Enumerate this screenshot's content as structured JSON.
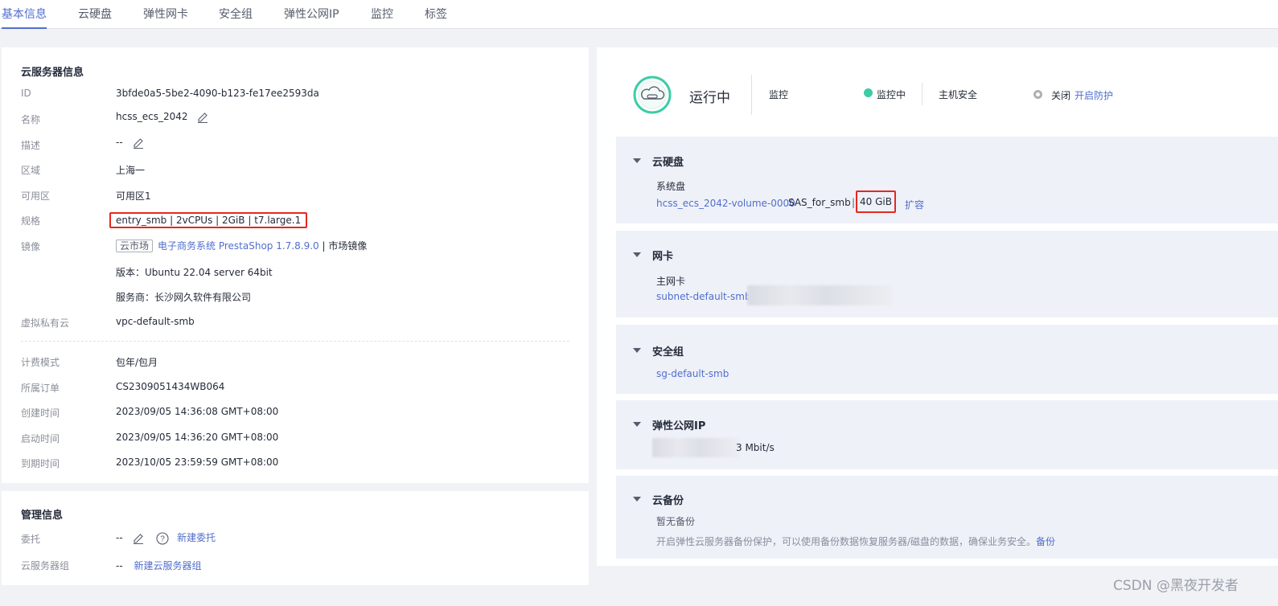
{
  "tabs": [
    {
      "label": "基本信息",
      "active": true
    },
    {
      "label": "云硬盘"
    },
    {
      "label": "弹性网卡"
    },
    {
      "label": "安全组"
    },
    {
      "label": "弹性公网IP"
    },
    {
      "label": "监控"
    },
    {
      "label": "标签"
    }
  ],
  "server_info": {
    "title": "云服务器信息",
    "id_label": "ID",
    "id": "3bfde0a5-5be2-4090-b123-fe17ee2593da",
    "name_label": "名称",
    "name": "hcss_ecs_2042",
    "desc_label": "描述",
    "desc": "--",
    "region_label": "区域",
    "region": "上海一",
    "az_label": "可用区",
    "az": "可用区1",
    "flavor_label": "规格",
    "flavor": "entry_smb | 2vCPUs | 2GiB | t7.large.1",
    "image_label": "镜像",
    "image_tag": "云市场",
    "image_link": "电子商务系统 PrestaShop 1.7.8.9.0",
    "image_suffix": " | 市场镜像",
    "version": "版本：Ubuntu 22.04 server 64bit",
    "vendor": "服务商：长沙网久软件有限公司",
    "vpc_label": "虚拟私有云",
    "vpc": "vpc-default-smb",
    "billing_label": "计费模式",
    "billing": "包年/包月",
    "order_label": "所属订单",
    "order": "CS2309051434WB064",
    "created_label": "创建时间",
    "created": "2023/09/05 14:36:08 GMT+08:00",
    "started_label": "启动时间",
    "started": "2023/09/05 14:36:20 GMT+08:00",
    "expire_label": "到期时间",
    "expire": "2023/10/05 23:59:59 GMT+08:00"
  },
  "mgmt_info": {
    "title": "管理信息",
    "delegate_label": "委托",
    "delegate": "--",
    "delegate_link": "新建委托",
    "group_label": "云服务器组",
    "group": "--",
    "group_link": "新建云服务器组"
  },
  "status": {
    "state": "运行中",
    "monitor_label": "监控",
    "monitor_state": "监控中",
    "host_security_label": "主机安全",
    "host_security_state": "关闭",
    "host_security_link": "开启防护"
  },
  "disk": {
    "title": "云硬盘",
    "sys_label": "系统盘",
    "volume": "hcss_ecs_2042-volume-0000",
    "type": "SAS_for_smb",
    "sep": "|",
    "size": "40 GiB",
    "expand": "扩容"
  },
  "nic": {
    "title": "网卡",
    "primary_label": "主网卡",
    "subnet": "subnet-default-smb"
  },
  "secgroup": {
    "title": "安全组",
    "name": "sg-default-smb"
  },
  "eip": {
    "title": "弹性公网IP",
    "bandwidth": "3 Mbit/s"
  },
  "backup": {
    "title": "云备份",
    "none": "暂无备份",
    "desc": "开启弹性云服务器备份保护，可以使用备份数据恢复服务器/磁盘的数据，确保业务安全。",
    "link": "备份"
  },
  "watermark": "CSDN @黑夜开发者",
  "colors": {
    "accent": "#526ecc",
    "highlight": "#e6281f",
    "running": "#3dcca6"
  }
}
